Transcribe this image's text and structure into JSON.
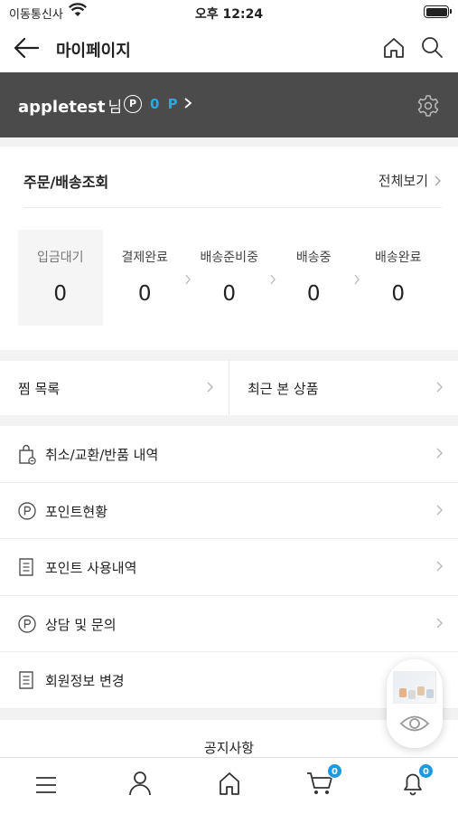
{
  "status": {
    "carrier": "이동통신사",
    "time": "오후 12:24"
  },
  "header": {
    "title": "마이페이지"
  },
  "user": {
    "name": "appletest",
    "suffix": "님",
    "point_icon": "P",
    "points": "0 P"
  },
  "orders": {
    "title": "주문/배송조회",
    "view_all": "전체보기",
    "steps": [
      {
        "label": "입금대기",
        "count": "0"
      },
      {
        "label": "결제완료",
        "count": "0"
      },
      {
        "label": "배송준비중",
        "count": "0"
      },
      {
        "label": "배송중",
        "count": "0"
      },
      {
        "label": "배송완료",
        "count": "0"
      }
    ]
  },
  "shortcuts": {
    "wishlist": "찜 목록",
    "recent": "최근 본 상품"
  },
  "menu": [
    {
      "label": "취소/교환/반품 내역",
      "icon": "bag-icon"
    },
    {
      "label": "포인트현황",
      "icon": "point-icon"
    },
    {
      "label": "포인트 사용내역",
      "icon": "document-icon"
    },
    {
      "label": "상담 및 문의",
      "icon": "point-icon"
    },
    {
      "label": "회원정보 변경",
      "icon": "document-icon"
    }
  ],
  "notice": {
    "label": "공지사항"
  },
  "tabbar": {
    "cart_badge": "0",
    "bell_badge": "0"
  },
  "colors": {
    "accent": "#1b9ae0",
    "user_bar": "#4b4b4b",
    "points": "#2aa7e8"
  }
}
